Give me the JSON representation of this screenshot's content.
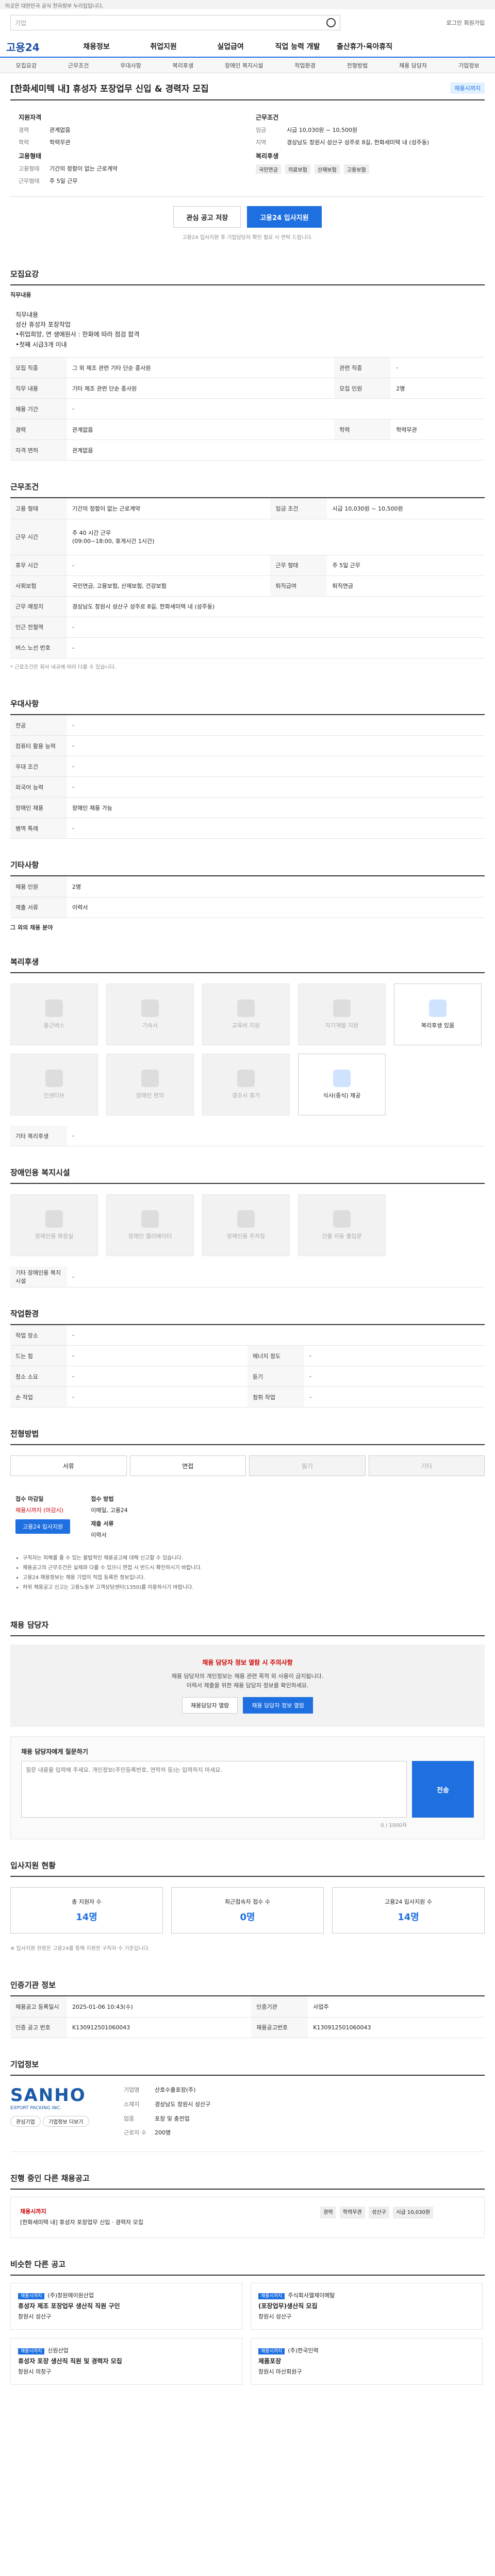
{
  "topbar": "이곳은 대한민국 공식 전자정부 누리집입니다.",
  "search": {
    "placeholder": "기업"
  },
  "util": "로그인  회원가입",
  "gnb": {
    "logo": "고용24",
    "items": [
      "채용정보",
      "취업지원",
      "실업급여",
      "직업 능력 개발",
      "출산휴가·육아휴직"
    ]
  },
  "anchors": [
    "모집요강",
    "근무조건",
    "우대사항",
    "복리후생",
    "장애인 복지시설",
    "작업환경",
    "전형방법",
    "채용 담당자",
    "기업정보"
  ],
  "title": "[한화세미텍 내] 휴성자 포장업무 신입 & 경력자 모집",
  "status": "채용시까지",
  "summary": {
    "left_title": "지원자격",
    "left": [
      {
        "k": "경력",
        "v": "관계없음"
      },
      {
        "k": "학력",
        "v": "학력무관"
      }
    ],
    "left2_title": "고용형태",
    "left2": [
      {
        "k": "고용형태",
        "v": "기간의 정함이 없는 근로계약"
      },
      {
        "k": "근무형태",
        "v": "주 5일 근무"
      }
    ],
    "right_title": "근무조건",
    "right": [
      {
        "k": "임금",
        "v": "시급 10,030원 ~ 10,500원"
      },
      {
        "k": "지역",
        "v": "경상남도 창원시 성산구 성주로 8길, 한화세미텍 내 (성주동)"
      }
    ],
    "right2_title": "복리후생",
    "chips": [
      "국민연금",
      "의료보험",
      "산재보험",
      "고용보험"
    ]
  },
  "actions": {
    "scrap": "관심 공고 저장",
    "apply": "고용24 입사지원"
  },
  "apply_note": "고용24 입사지원 후 기업담당자 확인 필요 시 연락 드립니다.",
  "recruit": {
    "title": "모집요강",
    "sub": "직무내용",
    "desc": "직무내용\n성산 휴성자 포장작업\n•취업희망, 연 생애원사 : 한화에 따라 점검 합격\n•첫째 시급3개 이내",
    "rows": [
      {
        "h": "모집 직종",
        "v": "그 외 제조 관련 기타 단순 종사원",
        "h2": "관련 직종",
        "v2": "-"
      },
      {
        "h": "직무 내용",
        "v": "기타 제조 관련 단순 종사원",
        "h2": "모집 인원",
        "v2": "2명"
      },
      {
        "h": "채용 기간",
        "v": "-",
        "h2": "",
        "v2": ""
      },
      {
        "h": "경력",
        "v": "관계없음",
        "h2": "학력",
        "v2": "학력무관"
      },
      {
        "h": "자격 면허",
        "v": "관계없음",
        "h2": "",
        "v2": ""
      }
    ]
  },
  "conditions": {
    "title": "근무조건",
    "rows": [
      {
        "h": "고용 형태",
        "v": "기간의 정함이 없는 근로계약",
        "h2": "임금 조건",
        "v2": "시급 10,030원 ~ 10,500원"
      },
      {
        "h": "근무 시간",
        "v": "주 40 시간 근무\n(09:00~18:00, 휴게시간 1시간)",
        "h2": "",
        "v2": ""
      },
      {
        "h": "휴무 시간",
        "v": "-",
        "h2": "근무 형태",
        "v2": "주 5일 근무"
      },
      {
        "h": "사회보험",
        "v": "국민연금, 고용보험, 산재보험, 건강보험",
        "h2": "퇴직급여",
        "v2": "퇴직연금"
      },
      {
        "h": "근무 예정지",
        "v": "경상남도 창원시 성산구 성주로 8길, 한화세미텍 내 (성주동)",
        "h2": "",
        "v2": ""
      },
      {
        "h": "인근 전철역",
        "v": "-",
        "h2": "",
        "v2": ""
      },
      {
        "h": "버스 노선 번호",
        "v": "-",
        "h2": "",
        "v2": ""
      }
    ],
    "note": "* 근로조건은 회사 내규에 따라 다를 수 있습니다."
  },
  "preference": {
    "title": "우대사항",
    "rows": [
      {
        "h": "전공",
        "v": "-"
      },
      {
        "h": "컴퓨터 활용 능력",
        "v": "-"
      },
      {
        "h": "우대 조건",
        "v": "-"
      },
      {
        "h": "외국어 능력",
        "v": "-"
      },
      {
        "h": "장애인 채용",
        "v": "장애인 채용 가능"
      },
      {
        "h": "병역 특례",
        "v": "-"
      }
    ]
  },
  "etc": {
    "title": "기타사항",
    "rows": [
      {
        "h": "채용 인원",
        "v": "2명"
      },
      {
        "h": "제출 서류",
        "v": "이력서"
      }
    ],
    "note": "그 외의 채용 분야"
  },
  "welfare": {
    "title": "복리후생",
    "items": [
      "통근버스",
      "기숙사",
      "교육비 지원",
      "자기계발 지원",
      "복리후생 있음",
      "인센티브",
      "장애인 편의",
      "경조사 휴가",
      "식사(중식) 제공"
    ],
    "extra_label": "기타 복리후생",
    "extra": "-"
  },
  "disability": {
    "title": "장애인용 복지시설",
    "items": [
      "장애인용 화장실",
      "장애인 엘리베이터",
      "장애인용 주차장",
      "건물 자동 출입문"
    ],
    "extra_label": "기타 장애인용 복지시설",
    "extra": "-"
  },
  "workenv": {
    "title": "작업환경",
    "rows": [
      {
        "h": "작업 장소",
        "v": "-",
        "h2": "",
        "v2": ""
      },
      {
        "h": "드는 힘",
        "v": "-",
        "h2": "에너지 정도",
        "v2": "-"
      },
      {
        "h": "청소 소요",
        "v": "-",
        "h2": "듣기",
        "v2": "-"
      },
      {
        "h": "손 작업",
        "v": "-",
        "h2": "청취 작업",
        "v2": "-"
      }
    ]
  },
  "process": {
    "title": "전형방법",
    "steps": [
      "서류",
      "면접",
      "필기",
      "기타"
    ],
    "apply_label": "접수 마감일",
    "apply_val": "채용시까지 (마감시)",
    "method_label": "접수 방법",
    "method_val": "이메일, 고용24",
    "doc_label": "제출 서류",
    "doc_val": "이력서",
    "apply_btn": "고용24 입사지원",
    "notes": [
      "구직자는 피해를 줄 수 있는 불법적인 채용공고에 대해 신고할 수 있습니다.",
      "채용공고의 근무조건은 실제와 다를 수 있으니 면접 시 반드시 확인하시기 바랍니다.",
      "고용24 채용정보는 채용 기업이 직접 등록한 정보입니다.",
      "허위 채용공고 신고는 고용노동부 고객상담센터(1350)를 이용하시기 바랍니다."
    ]
  },
  "contact": {
    "title": "채용 담당자",
    "warn": "채용 담당자 정보 열람 시 주의사항",
    "desc": "채용 담당자의 개인정보는 채용 관련 목적 외 사용이 금지됩니다.\n이력서 제출을 위한 채용 담당자 정보를 확인하세요.",
    "btn1": "채용담당자 열람",
    "btn2": "채용 담당자 정보 열람"
  },
  "qa": {
    "label": "채용 담당자에게 질문하기",
    "placeholder": "질문 내용을 입력해 주세요. 개인정보(주민등록번호, 연락처 등)는 입력하지 마세요.",
    "counter": "0 / 1000자",
    "send": "전송"
  },
  "stats": {
    "title": "입사지원 현황",
    "cards": [
      {
        "label": "총 지원자 수",
        "num": "14명"
      },
      {
        "label": "최근접속자 접수 수",
        "num": "0명"
      },
      {
        "label": "고용24 입사지원 수",
        "num": "14명"
      }
    ],
    "note": "※ 입사지원 현황은 고용24를 통해 지원한 구직자 수 기준입니다."
  },
  "hrinfo": {
    "title": "인증기관 정보",
    "rows": [
      {
        "h": "채용공고 등록일시",
        "v": "2025-01-06 10:43(수)",
        "h2": "인증기관",
        "v2": "사업주"
      },
      {
        "h": "인증 공고 번호",
        "v": "K130912501060043",
        "h2": "채용공고번호",
        "v2": "K130912501060043"
      }
    ]
  },
  "company": {
    "title": "기업정보",
    "logo": "SANHO",
    "logo_sub": "EXPORT PACKING INC.",
    "name_label": "기업명",
    "name": "산호수출포장(주)",
    "addr_label": "소재지",
    "addr": "경상남도 창원시 성산구",
    "biz_label": "업종",
    "biz": "포장 및 충전업",
    "emp_label": "근로자 수",
    "emp": "200명",
    "btns": [
      "관심기업",
      "기업정보 더보기"
    ]
  },
  "related": {
    "title": "진행 중인 다른 채용공고",
    "job_title": "채용시까지",
    "job_desc": "[한화세미텍 내] 휴성자 포장업무 신입 · 경력자 모집",
    "tags": [
      "경력",
      "학력무관",
      "성산구",
      "시급 10,030원"
    ]
  },
  "similar": {
    "title": "비슷한 다른 공고",
    "cards": [
      {
        "tag": "채용시까지",
        "org": "(주)창원에이원산업",
        "t": "휴성자 제조 포장업무 생산직 직원 구인",
        "d": "창원시 성산구"
      },
      {
        "tag": "채용시까지",
        "org": "주식회사엘제이메탈",
        "t": "(포장업무)생산직 모집",
        "d": "창원시 성산구"
      },
      {
        "tag": "채용시까지",
        "org": "신원산업",
        "t": "휴성자 포장 생산직 직원 및 경력자 모집",
        "d": "창원시 의창구"
      },
      {
        "tag": "채용시까지",
        "org": "(주)한국인력",
        "t": "제품포장",
        "d": "창원시 마산회원구"
      }
    ]
  }
}
